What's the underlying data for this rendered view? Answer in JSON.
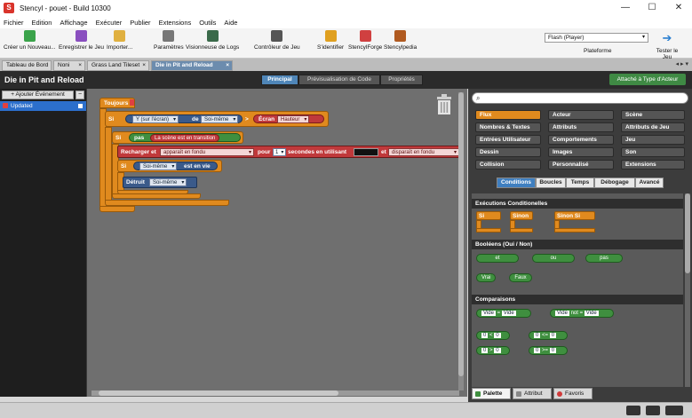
{
  "window": {
    "title": "Stencyl - pouet - Build 10300",
    "app_icon": "S",
    "controls": [
      "—",
      "☐",
      "✕"
    ]
  },
  "menubar": [
    "Fichier",
    "Edition",
    "Affichage",
    "Exécuter",
    "Publier",
    "Extensions",
    "Outils",
    "Aide"
  ],
  "toolbar": {
    "buttons": [
      {
        "label": "Créer un Nouveau...",
        "icon": "new-game-icon",
        "color": "#3aa34a"
      },
      {
        "label": "Enregistrer le Jeu",
        "icon": "save-icon",
        "color": "#8a4fbf"
      },
      {
        "label": "Importer...",
        "icon": "import-icon",
        "color": "#e0b040"
      },
      {
        "label": "Paramètres",
        "icon": "settings-icon",
        "color": "#777777"
      },
      {
        "label": "Visionneuse de Logs",
        "icon": "log-viewer-icon",
        "color": "#3a6a4a"
      },
      {
        "label": "Contrôleur de Jeu",
        "icon": "game-controller-icon",
        "color": "#555555"
      },
      {
        "label": "S'identifier",
        "icon": "key-icon",
        "color": "#e0a020"
      },
      {
        "label": "StencylForge",
        "icon": "forge-icon",
        "color": "#d04040"
      },
      {
        "label": "Stencylpedia",
        "icon": "book-icon",
        "color": "#b05a20"
      }
    ],
    "platform_select": "Flash (Player)",
    "platform_label": "Plateforme",
    "test_label": "Tester le Jeu"
  },
  "tabs": [
    {
      "label": "Tableau de Bord",
      "closable": false
    },
    {
      "label": "Noni",
      "closable": true
    },
    {
      "label": "Grass Land Tileset",
      "closable": true
    },
    {
      "label": "Die in Pit and Reload",
      "closable": true,
      "active": true
    }
  ],
  "tab_nav": "◂ ▸ ▾",
  "header": {
    "title": "Die in Pit and Reload",
    "segments": [
      "Principal",
      "Prévisualisation de Code",
      "Propriétés"
    ],
    "attach_button": "Attaché à Type d'Acteur"
  },
  "events_panel": {
    "add_button": "+ Ajouter Événement",
    "remove_button": "−",
    "items": [
      {
        "label": "Updated"
      }
    ]
  },
  "blocks": {
    "always": "Toujours",
    "if1": "Si",
    "y_on_screen": "Y (sur l'écran)",
    "of": "de",
    "self": "Soi-même",
    "gt": ">",
    "screen": "Écran",
    "height": "Hauteur",
    "if2": "Si",
    "not": "pas",
    "scene_transition": "La scène est en transition",
    "reload": "Recharger et",
    "fade_in": "apparaît en fondu",
    "for": "pour",
    "seconds_val": "1",
    "seconds_using": "secondes en utilisant",
    "and": "et",
    "fade_out": "disparaît en fondu",
    "if3": "Si",
    "self2": "Soi-même",
    "is_alive": "est en vie",
    "kill": "Détruit",
    "self3": "Soi-même"
  },
  "right_panel": {
    "search_placeholder": "",
    "categories": [
      [
        "Flux",
        "Acteur",
        "Scène"
      ],
      [
        "Nombres & Textes",
        "Attributs",
        "Attributs de Jeu"
      ],
      [
        "Entrées Utilisateur",
        "Comportements",
        "Jeu"
      ],
      [
        "Dessin",
        "Images",
        "Son"
      ],
      [
        "Collision",
        "Personnalisé",
        "Extensions"
      ]
    ],
    "subtabs": [
      "Conditions",
      "Boucles",
      "Temps",
      "Débogage",
      "Avancé"
    ],
    "sections": {
      "conditionals": "Exécutions Conditionelles",
      "cond_blocks": [
        "Si",
        "Sinon",
        "Sinon Si"
      ],
      "booleans": "Booléens (Oui / Non)",
      "bool_blocks": [
        "et",
        "ou",
        "pas",
        "Vrai",
        "Faux"
      ],
      "comparisons": "Comparaisons",
      "cmp_empty": "Vide",
      "cmp_eq": "=",
      "cmp_not": "not =",
      "cmp_zero": "0",
      "cmp_ops": [
        "<",
        "<=",
        ">",
        ">="
      ]
    },
    "bottom_tabs": [
      "Palette",
      "Attribut",
      "Favoris"
    ]
  }
}
